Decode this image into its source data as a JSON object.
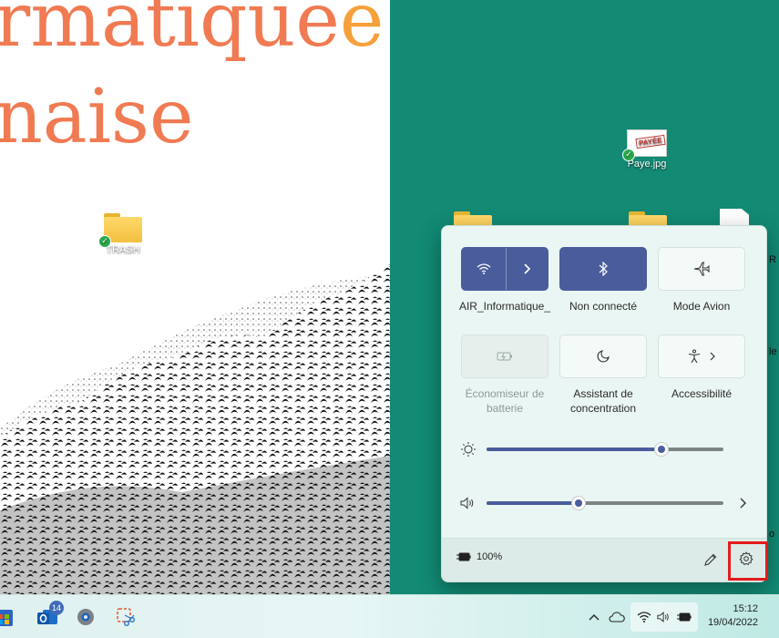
{
  "wallpaper": {
    "title_line1": "rmatique",
    "title_line1_accent": "e",
    "title_line2": "naise",
    "color_right": "#128a74",
    "color_text": "#f07a52"
  },
  "desktop_icons": {
    "trash_label": "TRASH",
    "paye_label": "Paye.jpg",
    "paye_stamp": "PAYÉE"
  },
  "edge_fragments": [
    "R",
    "le",
    "o"
  ],
  "quick_settings": {
    "tiles": [
      {
        "label": "AIR_Informatique_",
        "icon": "wifi-icon",
        "state": "on"
      },
      {
        "label": "Non connecté",
        "icon": "bluetooth-icon",
        "state": "on"
      },
      {
        "label": "Mode Avion",
        "icon": "airplane-icon",
        "state": "off"
      },
      {
        "label": "Économiseur de batterie",
        "icon": "battery-saver-icon",
        "state": "disabled"
      },
      {
        "label": "Assistant de concentration",
        "icon": "moon-icon",
        "state": "off"
      },
      {
        "label": "Accessibilité",
        "icon": "accessibility-icon",
        "state": "off"
      }
    ],
    "brightness": {
      "icon": "brightness-icon",
      "level": 0.74
    },
    "volume": {
      "icon": "speaker-icon",
      "level": 0.39
    },
    "battery_text": "100%",
    "accent": "#4a5c9c"
  },
  "taskbar": {
    "outlook_badge": "14",
    "time": "15:12",
    "date": "19/04/2022"
  }
}
